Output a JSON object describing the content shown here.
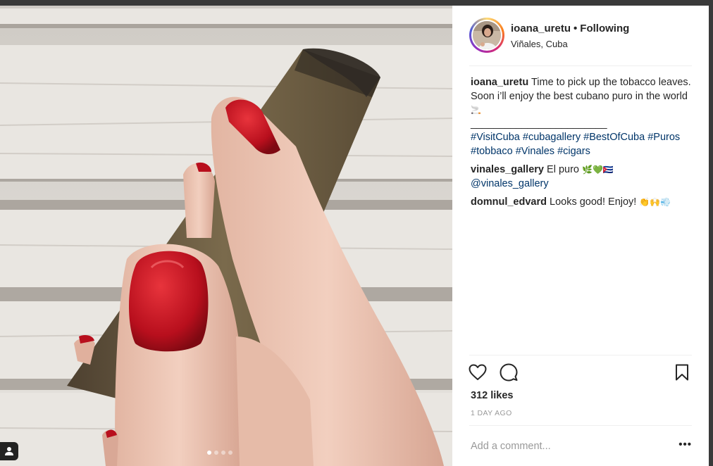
{
  "post": {
    "username": "ioana_uretu",
    "separator": "•",
    "follow_status": "Following",
    "location": "Viñales, Cuba",
    "caption": {
      "username": "ioana_uretu",
      "text": "Time to pick up the tobacco leaves. Soon i’ll enjoy the best cubano puro in the world",
      "emoji": "🚬",
      "rule": "________________________",
      "hashtags": "#VisitCuba #cubagallery #BestOfCuba #Puros #tobbaco #Vinales #cigars"
    },
    "comments": [
      {
        "username": "vinales_gallery",
        "text": "El puro",
        "emoji": "🌿💚🇨🇺",
        "mention": "@vinales_gallery"
      },
      {
        "username": "domnul_edvard",
        "text": "Looks good! Enjoy!",
        "emoji": "👏🙌💨"
      }
    ],
    "likes": "312 likes",
    "timestamp": "1 DAY AGO",
    "comment_placeholder": "Add a comment...",
    "more_label": "•••"
  },
  "carousel": {
    "count": 4,
    "active": 1
  },
  "icons": [
    "heart-icon",
    "comment-icon",
    "bookmark-icon",
    "user-tag-icon",
    "more-options-icon"
  ],
  "colors": {
    "link": "#003569",
    "muted": "#999999",
    "text": "#262626",
    "divider": "#efefef",
    "nail": "#c8102e"
  }
}
